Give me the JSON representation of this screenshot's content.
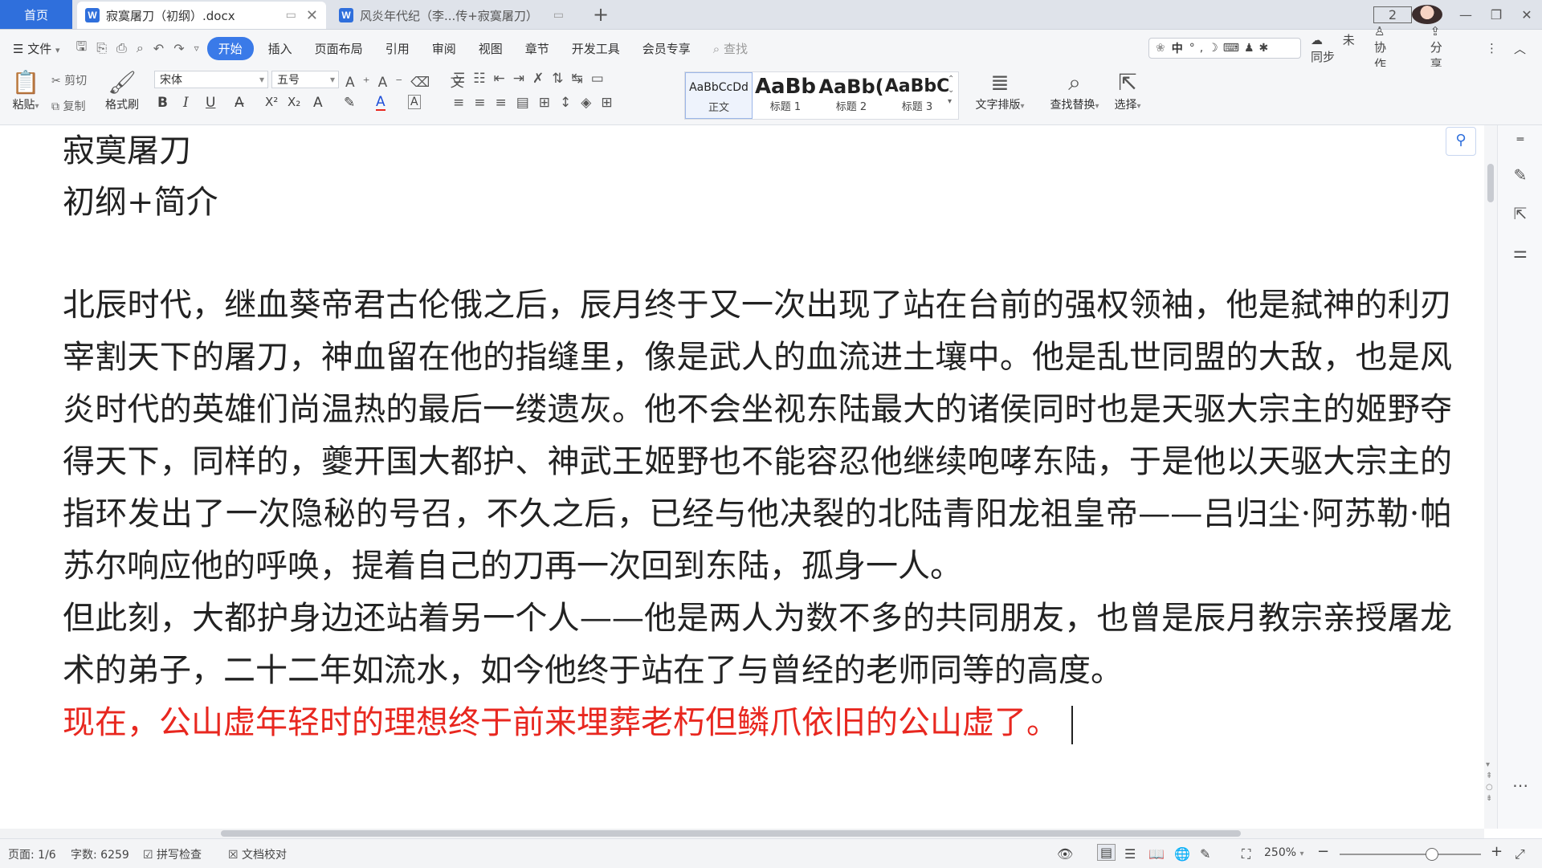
{
  "tabs": {
    "home": "首页",
    "doc1": "寂寞屠刀（初纲）.docx",
    "doc2": "风炎年代纪（李...传+寂寞屠刀）"
  },
  "window": {
    "badge": "2"
  },
  "menu": {
    "file": "文件",
    "items": [
      "开始",
      "插入",
      "页面布局",
      "引用",
      "审阅",
      "视图",
      "章节",
      "开发工具",
      "会员专享"
    ],
    "search_placeholder": "查找",
    "ime": "中",
    "unsynced": "未同步",
    "collab": "协作",
    "share": "分享"
  },
  "ribbon": {
    "paste": "粘贴",
    "cut": "剪切",
    "copy": "复制",
    "format_painter": "格式刷",
    "font_name": "宋体",
    "font_size": "五号",
    "styles": [
      {
        "preview": "AaBbCcDd",
        "label": "正文"
      },
      {
        "preview": "AaBb",
        "label": "标题 1"
      },
      {
        "preview": "AaBb(",
        "label": "标题 2"
      },
      {
        "preview": "AaBbC",
        "label": "标题 3"
      }
    ],
    "text_layout": "文字排版",
    "find_replace": "查找替换",
    "select": "选择"
  },
  "document": {
    "title": "寂寞屠刀",
    "subtitle": "初纲+简介",
    "paragraph1": "北辰时代，继血葵帝君古伦俄之后，辰月终于又一次出现了站在台前的强权领袖，他是弑神的利刃宰割天下的屠刀，神血留在他的指缝里，像是武人的血流进土壤中。他是乱世同盟的大敌，也是风炎时代的英雄们尚温热的最后一缕遗灰。他不会坐视东陆最大的诸侯同时也是天驱大宗主的姬野夺得天下，同样的，夔开国大都护、神武王姬野也不能容忍他继续咆哮东陆，于是他以天驱大宗主的指环发出了一次隐秘的号召，不久之后，已经与他决裂的北陆青阳龙祖皇帝——吕归尘·阿苏勒·帕苏尔响应他的呼唤，提着自己的刀再一次回到东陆，孤身一人。",
    "paragraph2": "但此刻，大都护身边还站着另一个人——他是两人为数不多的共同朋友，也曾是辰月教宗亲授屠龙术的弟子，二十二年如流水，如今他终于站在了与曾经的老师同等的高度。",
    "paragraph3": "现在，公山虚年轻时的理想终于前来埋葬老朽但鳞爪依旧的公山虚了。",
    "paragraph3_color": "#e8271f"
  },
  "status": {
    "page": "页面: 1/6",
    "words": "字数: 6259",
    "spellcheck": "拼写检查",
    "proofread": "文档校对",
    "zoom": "250%"
  }
}
